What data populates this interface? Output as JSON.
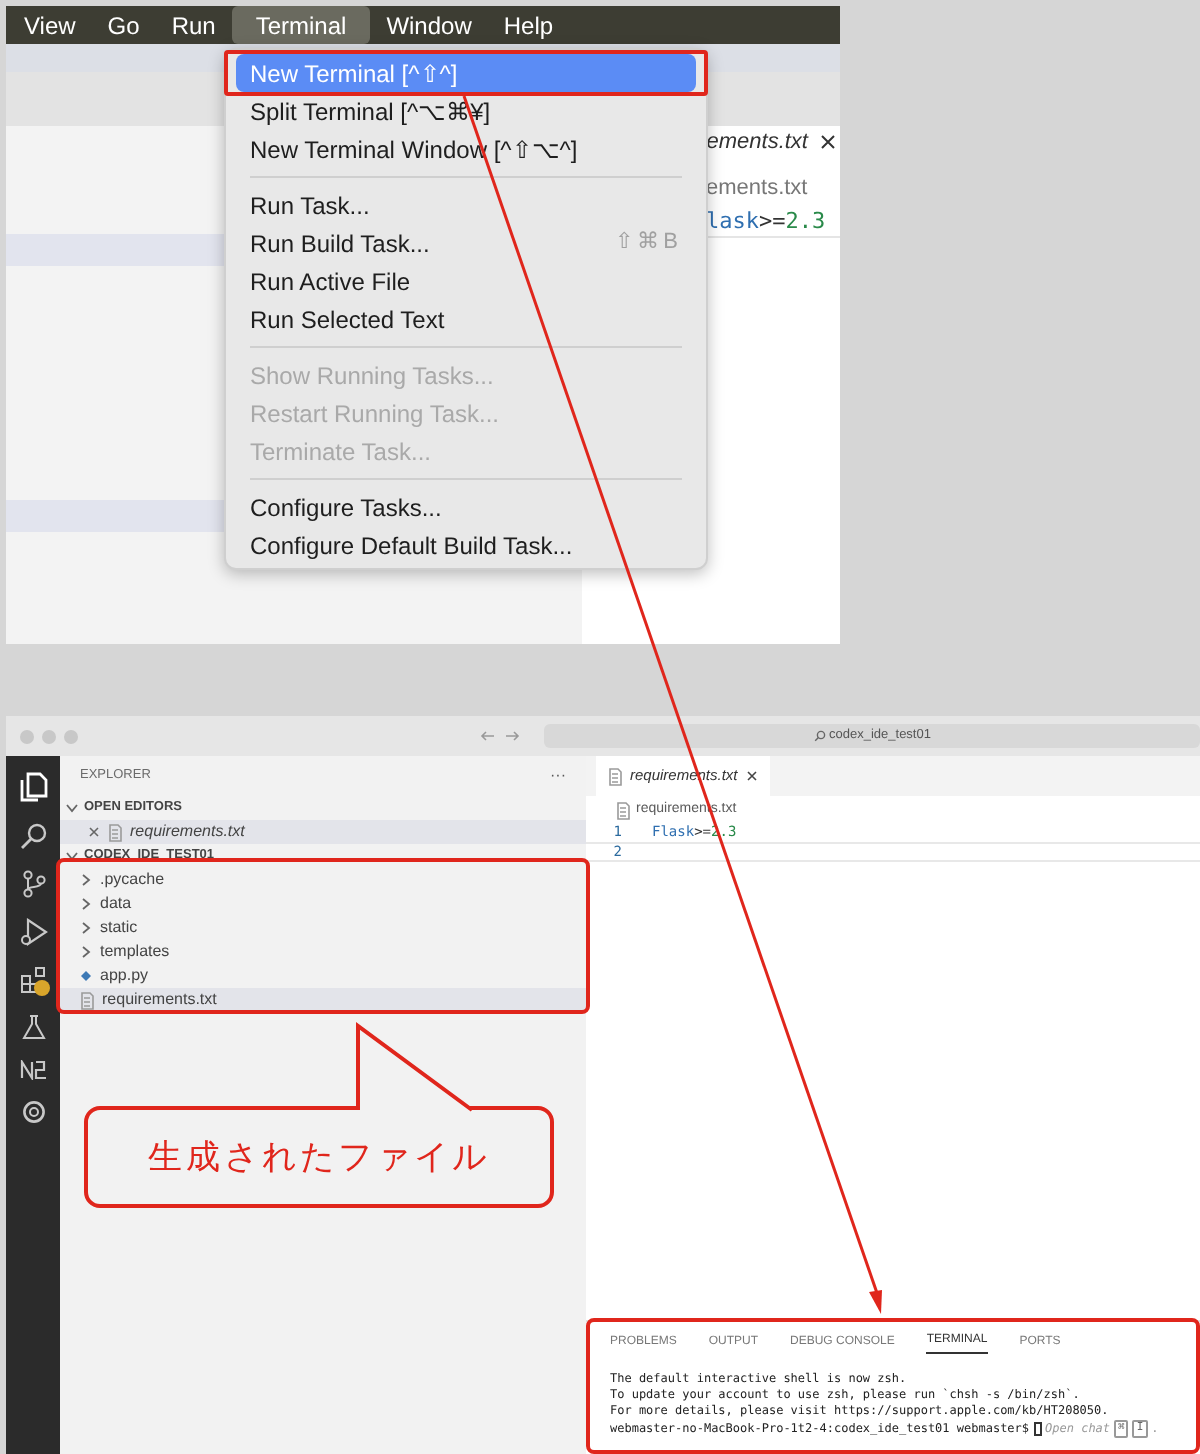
{
  "top_screenshot": {
    "menu_bar": [
      {
        "label": "View",
        "selected": false
      },
      {
        "label": "Go",
        "selected": false
      },
      {
        "label": "Run",
        "selected": false
      },
      {
        "label": "Terminal",
        "selected": true
      },
      {
        "label": "Window",
        "selected": false
      },
      {
        "label": "Help",
        "selected": false
      }
    ],
    "menu": [
      {
        "kind": "item",
        "label": "New Terminal [^⇧^]",
        "selected": true,
        "disabled": false
      },
      {
        "kind": "item",
        "label": "Split Terminal [^⌥⌘¥]",
        "selected": false,
        "disabled": false
      },
      {
        "kind": "item",
        "label": "New Terminal Window [^⇧⌥^]",
        "selected": false,
        "disabled": false
      },
      {
        "kind": "separator"
      },
      {
        "kind": "item",
        "label": "Run Task...",
        "selected": false,
        "disabled": false
      },
      {
        "kind": "item",
        "label": "Run Build Task...",
        "shortcut": "⇧⌘B",
        "selected": false,
        "disabled": false
      },
      {
        "kind": "item",
        "label": "Run Active File",
        "selected": false,
        "disabled": false
      },
      {
        "kind": "item",
        "label": "Run Selected Text",
        "selected": false,
        "disabled": false
      },
      {
        "kind": "separator"
      },
      {
        "kind": "item",
        "label": "Show Running Tasks...",
        "selected": false,
        "disabled": true
      },
      {
        "kind": "item",
        "label": "Restart Running Task...",
        "selected": false,
        "disabled": true
      },
      {
        "kind": "item",
        "label": "Terminate Task...",
        "selected": false,
        "disabled": true
      },
      {
        "kind": "separator"
      },
      {
        "kind": "item",
        "label": "Configure Tasks...",
        "selected": false,
        "disabled": false
      },
      {
        "kind": "item",
        "label": "Configure Default Build Task...",
        "selected": false,
        "disabled": false
      }
    ],
    "editor": {
      "tab": "ements.txt",
      "breadcrumb": "ements.txt",
      "code": [
        {
          "kind": "name",
          "text": "lask"
        },
        {
          "kind": "operator",
          "text": ">="
        },
        {
          "kind": "number",
          "text": "2.3"
        }
      ]
    }
  },
  "bottom_screenshot": {
    "search": "codex_ide_test01",
    "explorer": {
      "title": "EXPLORER",
      "more": "···",
      "sections": [
        {
          "title": "OPEN EDITORS",
          "expanded": true,
          "items": [
            {
              "kind": "open-editor",
              "label": "requirements.txt",
              "selected": true
            }
          ]
        },
        {
          "title": "CODEX_IDE_TEST01",
          "expanded": true,
          "items": [
            {
              "kind": "folder",
              "label": ".pycache",
              "selected": false,
              "expanded": false
            },
            {
              "kind": "folder",
              "label": "data",
              "selected": false,
              "expanded": false
            },
            {
              "kind": "folder",
              "label": "static",
              "selected": false,
              "expanded": false
            },
            {
              "kind": "folder",
              "label": "templates",
              "selected": false,
              "expanded": false
            },
            {
              "kind": "python",
              "label": "app.py",
              "selected": false
            },
            {
              "kind": "text",
              "label": "requirements.txt",
              "selected": true
            }
          ]
        }
      ]
    },
    "editor": {
      "tab": "requirements.txt",
      "breadcrumb": "requirements.txt",
      "lines": [
        {
          "number": "1",
          "tokens": [
            {
              "kind": "name",
              "text": "Flask"
            },
            {
              "kind": "operator",
              "text": ">="
            },
            {
              "kind": "number",
              "text": "2.3"
            }
          ]
        },
        {
          "number": "2"
        }
      ]
    },
    "panel": {
      "tabs": [
        {
          "label": "PROBLEMS",
          "selected": false
        },
        {
          "label": "OUTPUT",
          "selected": false
        },
        {
          "label": "DEBUG CONSOLE",
          "selected": false
        },
        {
          "label": "TERMINAL",
          "selected": true
        },
        {
          "label": "PORTS",
          "selected": false
        }
      ],
      "terminal": {
        "lines": [
          "The default interactive shell is now zsh.",
          "To update your account to use zsh, please run `chsh -s /bin/zsh`.",
          "For more details, please visit https://support.apple.com/kb/HT208050."
        ],
        "prompt": "webmaster-no-MacBook-Pro-1t2-4:codex_ide_test01 webmaster$",
        "hint": "Open chat",
        "keys": [
          "⌘",
          "I"
        ],
        "hint_end": "."
      }
    }
  },
  "callout": "生成されたファイル"
}
